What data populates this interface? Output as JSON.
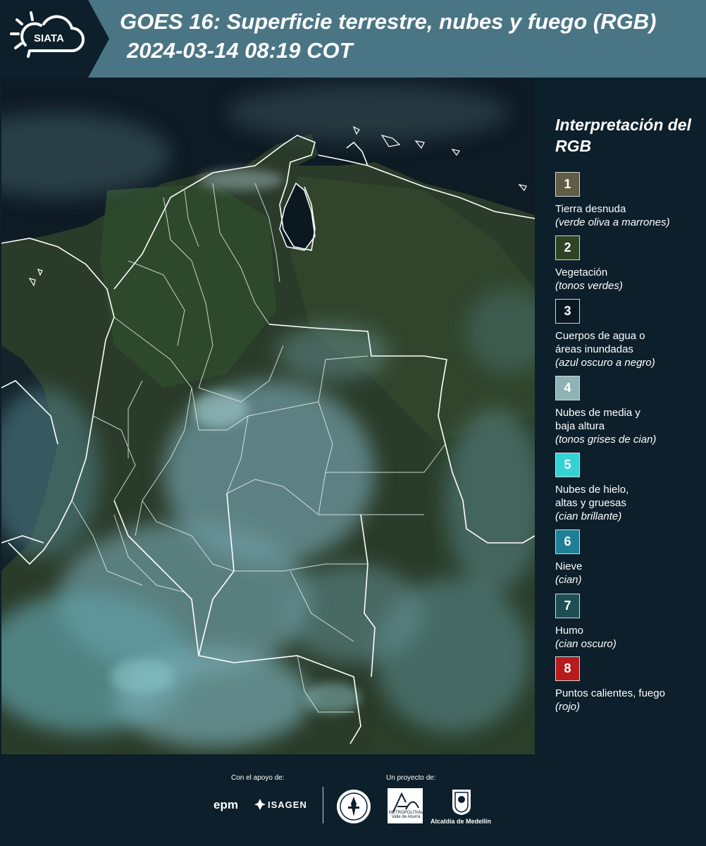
{
  "header": {
    "logo_text": "SIATA",
    "title": "GOES 16: Superficie terrestre, nubes y fuego (RGB)",
    "subtitle": "2024-03-14 08:19 COT"
  },
  "legend": {
    "title": "Interpretación del RGB",
    "items": [
      {
        "number": "1",
        "label": "Tierra desnuda",
        "desc": "(verde oliva a marrones)",
        "color": "#5f5d45"
      },
      {
        "number": "2",
        "label": "Vegetación",
        "desc": "(tonos verdes)",
        "color": "#2e4322"
      },
      {
        "number": "3",
        "label": "Cuerpos de agua o áreas inundadas",
        "desc": "(azul oscuro a negro)",
        "color": "#0b1820"
      },
      {
        "number": "4",
        "label": "Nubes de media y baja altura",
        "desc": "(tonos grises de cian)",
        "color": "#8fb3b4"
      },
      {
        "number": "5",
        "label": "Nubes de hielo, altas y gruesas",
        "desc": "(cian brillante)",
        "color": "#33d3d4"
      },
      {
        "number": "6",
        "label": "Nieve",
        "desc": "(cian)",
        "color": "#1f7f95"
      },
      {
        "number": "7",
        "label": "Humo",
        "desc": "(cian oscuro)",
        "color": "#1d4e54"
      },
      {
        "number": "8",
        "label": "Puntos calientes, fuego",
        "desc": "(rojo)",
        "color": "#b71c1c"
      }
    ]
  },
  "footer": {
    "support_label": "Con el apoyo de:",
    "project_label": "Un proyecto de:",
    "epm": "epm",
    "isagen": "ISAGEN",
    "amva": "METROPOLITANA Valle de Aburrá",
    "medellin": "Alcaldía de Medellín"
  },
  "colors": {
    "background": "#0c1f2b",
    "header": "#4a7585",
    "border_lines": "#ffffff"
  }
}
